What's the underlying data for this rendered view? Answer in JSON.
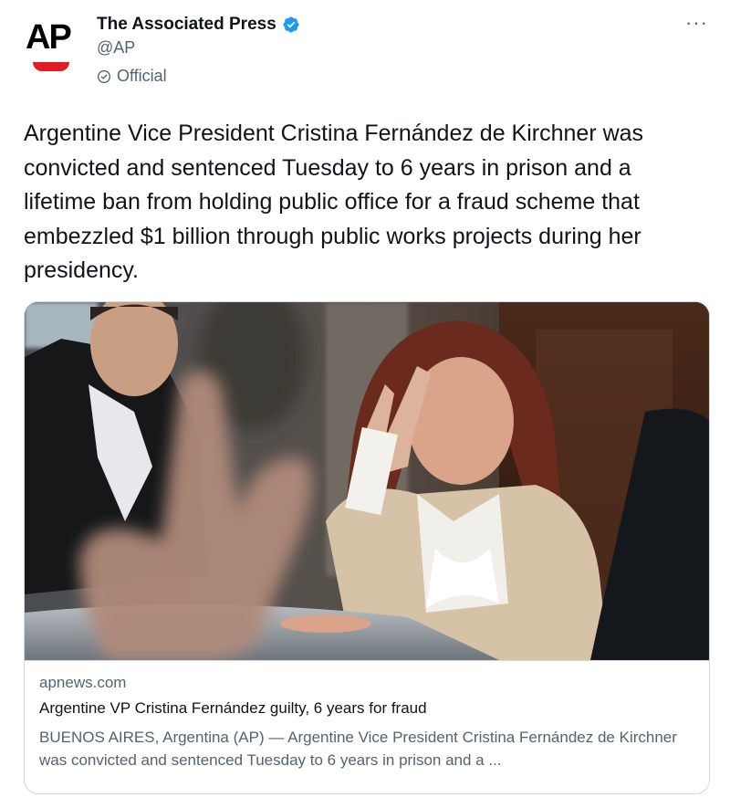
{
  "account": {
    "name": "The Associated Press",
    "handle": "@AP",
    "label": "Official",
    "avatar_text": "AP",
    "brand_color": "#e31b23",
    "verified_color": "#1d9bf0"
  },
  "menu": {
    "label": "···"
  },
  "tweet": {
    "text": "Argentine Vice President Cristina Fernández de Kirchner was convicted and sentenced Tuesday to 6 years in prison and a lifetime ban from holding public office for a fraud scheme that embezzled $1 billion through public works projects during her presidency."
  },
  "card": {
    "domain": "apnews.com",
    "title": "Argentine VP Cristina Fernández guilty, 6 years for fraud",
    "description": "BUENOS AIRES, Argentina (AP) — Argentine Vice President Cristina Fernández de Kirchner was convicted and sentenced Tuesday to 6 years in prison and a ..."
  }
}
